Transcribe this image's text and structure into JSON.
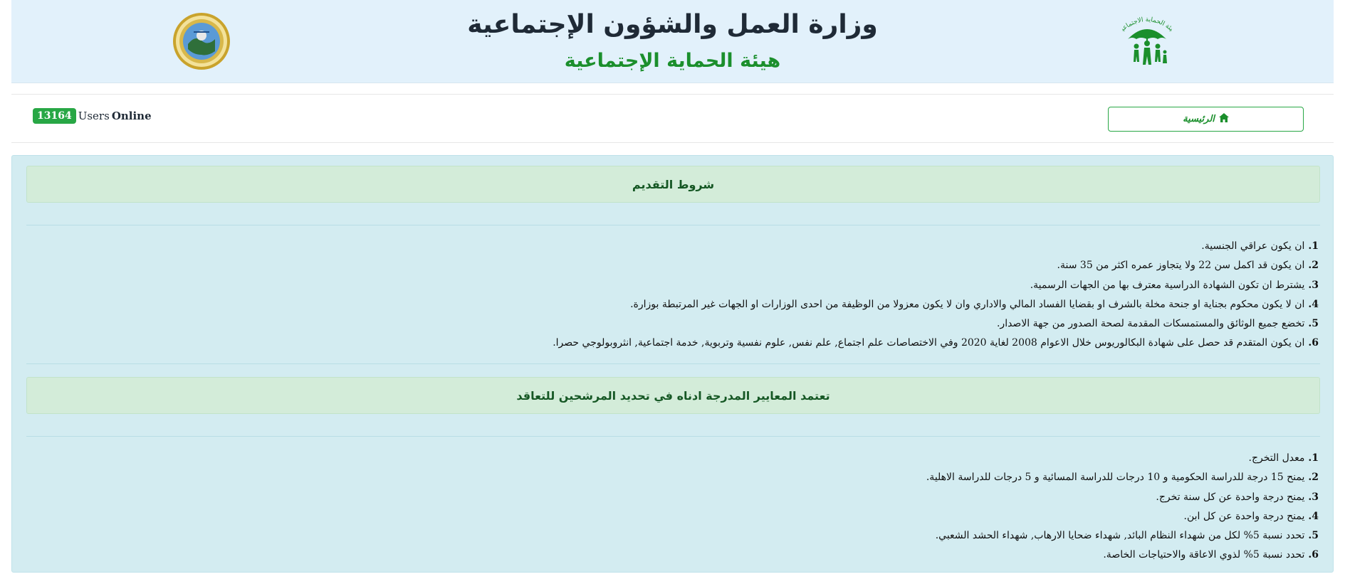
{
  "header": {
    "title": "وزارة العمل والشؤون الإجتماعية",
    "subtitle": "هيئة الحماية الإجتماعية",
    "left_logo": "ministry-seal-icon",
    "right_logo": "umbrella-family-logo-icon",
    "right_logo_text": "هيئة الحماية الاجتماعية"
  },
  "nav": {
    "online_count": "13164",
    "users_label": "Users",
    "online_label": "Online",
    "home_label": "الرئيسية",
    "home_icon": "home-icon"
  },
  "conditions": {
    "title": "شروط التقديم",
    "items": [
      {
        "num": "1.",
        "text": "ان يكون عراقي الجنسية."
      },
      {
        "num": "2.",
        "text": "ان يكون قد اكمل سن 22 ولا يتجاوز عمره اكثر من 35 سنة."
      },
      {
        "num": "3.",
        "text": "يشترط ان تكون الشهادة الدراسية معترف بها من الجهات الرسمية."
      },
      {
        "num": "4.",
        "text": "ان لا يكون محكوم بجناية او جنحة مخلة بالشرف او بقضايا الفساد المالي والاداري وان لا يكون معزولا من الوظيفة من احدى الوزارات او الجهات غير المرتبطة بوزارة."
      },
      {
        "num": "5.",
        "text": "تخضع جميع الوثائق والمستمسكات المقدمة لصحة الصدور من جهة الاصدار."
      },
      {
        "num": "6.",
        "text": "ان يكون المتقدم قد حصل على شهادة البكالوريوس خلال الاعوام 2008 لغاية 2020 وفي الاختصاصات علم اجتماع, علم نفس, علوم نفسية وتربوية, خدمة اجتماعية, انثروبولوجي حصرا."
      }
    ]
  },
  "criteria": {
    "title": "تعتمد المعايير المدرجة ادناه في تحديد المرشحين للتعاقد",
    "items": [
      {
        "num": "1.",
        "text": "معدل التخرج."
      },
      {
        "num": "2.",
        "text": "يمنح 15 درجة للدراسة الحكومية و 10 درجات للدراسة المسائية و 5 درجات للدراسة الاهلية."
      },
      {
        "num": "3.",
        "text": "يمنح درجة واحدة عن كل سنة تخرج."
      },
      {
        "num": "4.",
        "text": "يمنح درجة واحدة عن كل ابن."
      },
      {
        "num": "5.",
        "text": "تحدد نسبة 5% لكل من شهداء النظام البائد, شهداء ضحايا الارهاب, شهداء الحشد الشعبي."
      },
      {
        "num": "6.",
        "text": "تحدد نسبة 5% لذوي الاعاقة والاحتياجات الخاصة."
      }
    ]
  },
  "colors": {
    "brand_green": "#1b8f2c",
    "badge_green": "#28a745",
    "header_bg": "#e2f1fb",
    "panel_bg": "#d3ecf1",
    "section_head_bg": "#d3ecd9"
  }
}
